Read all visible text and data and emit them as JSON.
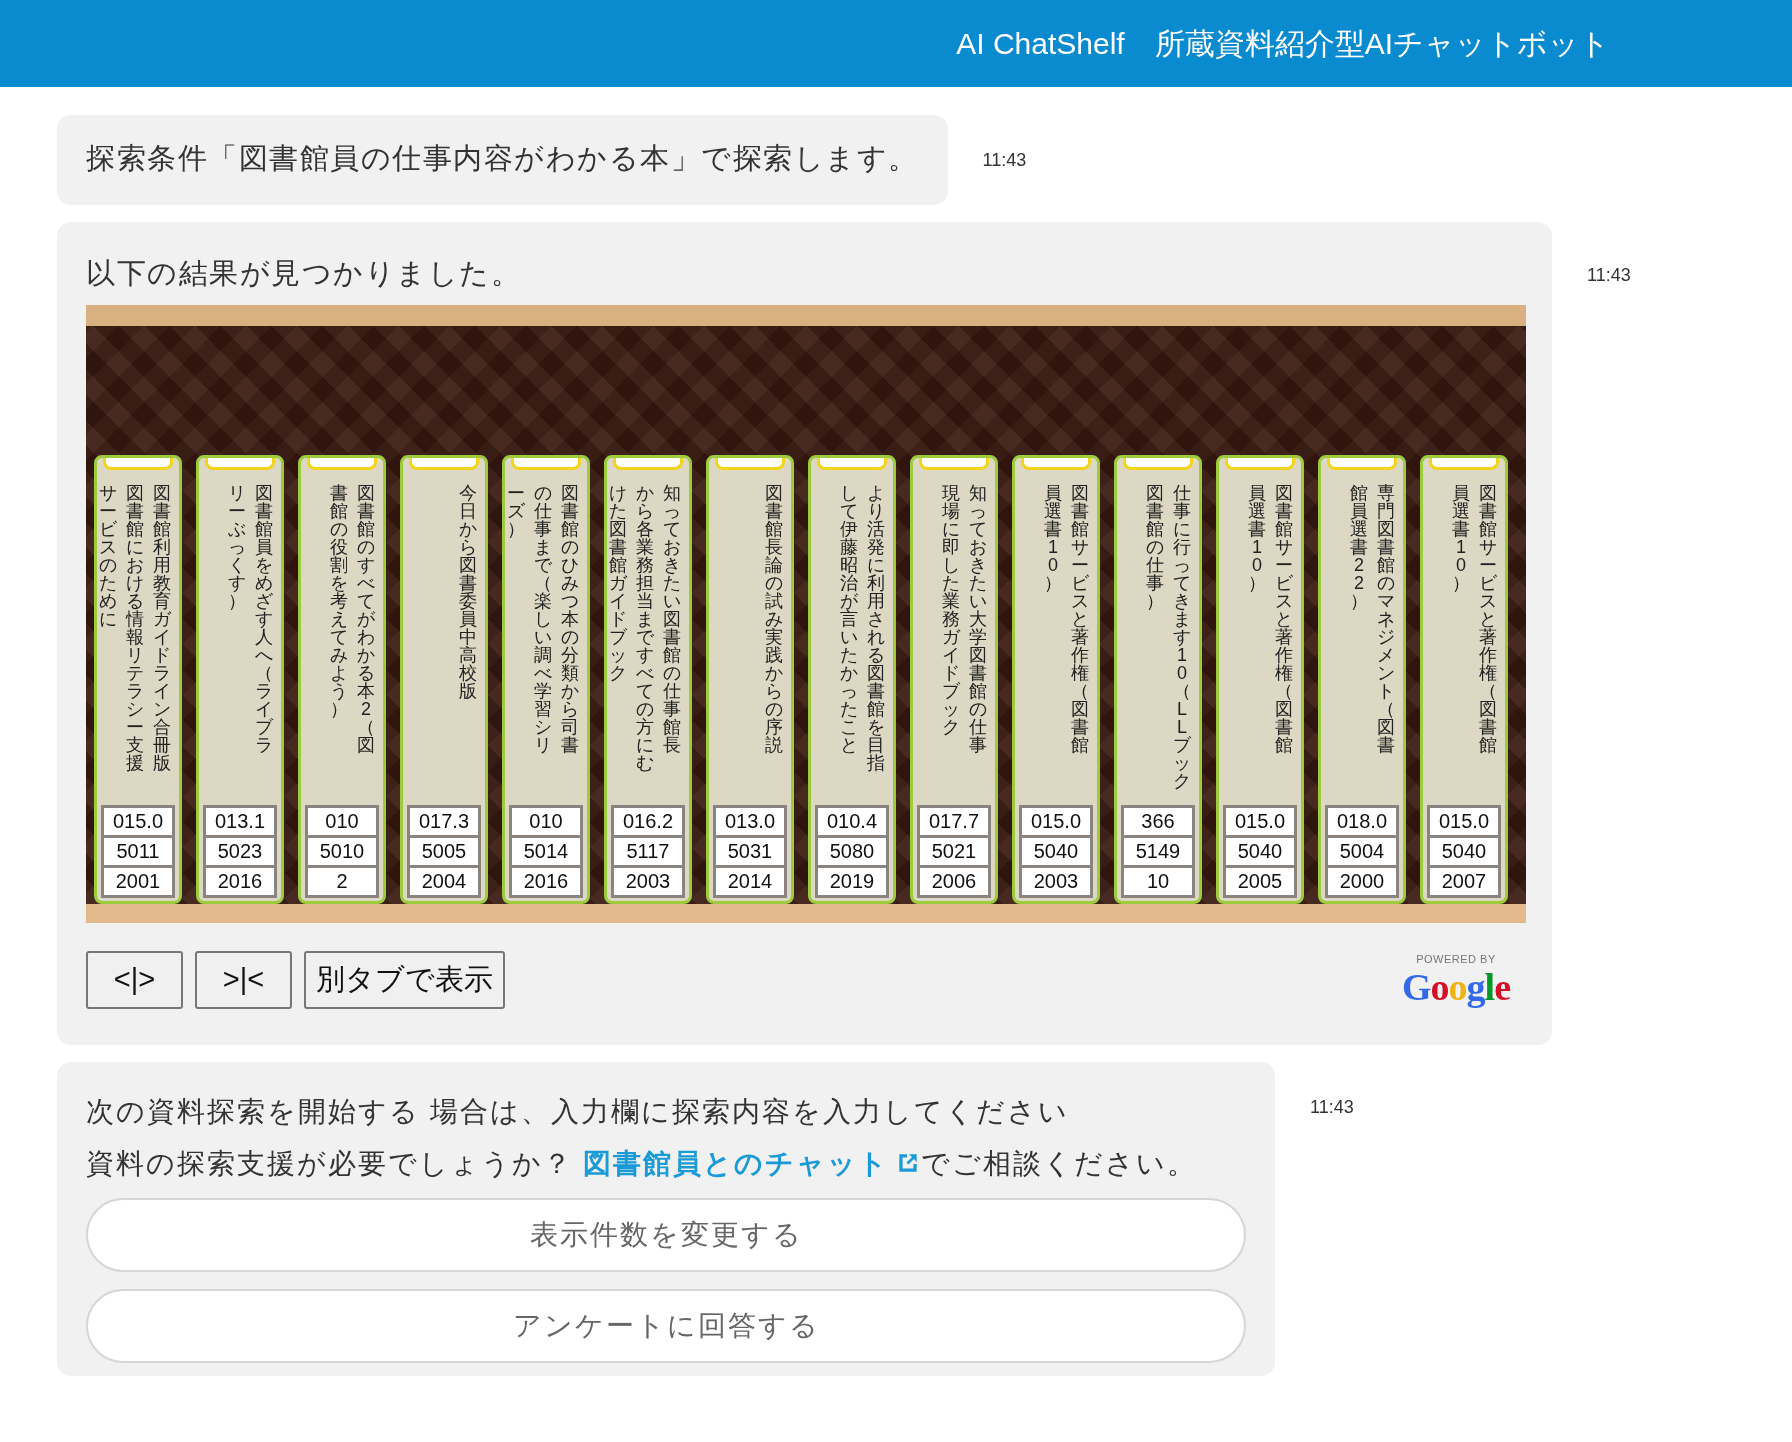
{
  "header": {
    "title": "AI ChatShelf　所蔵資料紹介型AIチャットボット"
  },
  "messages": [
    {
      "kind": "query",
      "text": "探索条件「図書館員の仕事内容がわかる本」で探索します。",
      "time": "11:43"
    },
    {
      "kind": "results",
      "text": "以下の結果が見つかりました。",
      "time": "11:43",
      "books": [
        {
          "spine_lines": [
            "サービスのために",
            "図書館における情報リテラシー支援",
            "図書館利用教育ガイドライン合冊版"
          ],
          "label_rows": [
            "015.0",
            "5011",
            "2001"
          ]
        },
        {
          "spine_lines": [
            "リーぶっくす）",
            "図書館員をめざす人へ（ライブラ"
          ],
          "label_rows": [
            "013.1",
            "5023",
            "2016"
          ]
        },
        {
          "spine_lines": [
            "書館の役割を考えてみよう）",
            "図書館のすべてがわかる本2（図"
          ],
          "label_rows": [
            "010",
            "5010",
            "2"
          ]
        },
        {
          "spine_lines": [
            "今日から図書委員中高校版"
          ],
          "label_rows": [
            "017.3",
            "5005",
            "2004"
          ]
        },
        {
          "spine_lines": [
            "ーズ）",
            "の仕事まで（楽しい調べ学習シリ",
            "図書館のひみつ本の分類から司書"
          ],
          "label_rows": [
            "010",
            "5014",
            "2016"
          ]
        },
        {
          "spine_lines": [
            "けた図書館ガイドブック",
            "から各業務担当まですべての方にむ",
            "知っておきたい図書館の仕事館長"
          ],
          "label_rows": [
            "016.2",
            "5117",
            "2003"
          ]
        },
        {
          "spine_lines": [
            "図書館長論の試み実践からの序説"
          ],
          "label_rows": [
            "013.0",
            "5031",
            "2014"
          ]
        },
        {
          "spine_lines": [
            "して伊藤昭治が言いたかったこと",
            "より活発に利用される図書館を目指"
          ],
          "label_rows": [
            "010.4",
            "5080",
            "2019"
          ]
        },
        {
          "spine_lines": [
            "現場に即した業務ガイドブック",
            "知っておきたい大学図書館の仕事"
          ],
          "label_rows": [
            "017.7",
            "5021",
            "2006"
          ]
        },
        {
          "spine_lines": [
            "員選書10）",
            "図書館サービスと著作権（図書館"
          ],
          "label_rows": [
            "015.0",
            "5040",
            "2003"
          ]
        },
        {
          "spine_lines": [
            "図書館の仕事）",
            "仕事に行ってきます10（LLブック"
          ],
          "label_rows": [
            "366",
            "5149",
            "10"
          ]
        },
        {
          "spine_lines": [
            "員選書10）",
            "図書館サービスと著作権（図書館"
          ],
          "label_rows": [
            "015.0",
            "5040",
            "2005"
          ]
        },
        {
          "spine_lines": [
            "館員選書22）",
            "専門図書館のマネジメント（図書"
          ],
          "label_rows": [
            "018.0",
            "5004",
            "2000"
          ]
        },
        {
          "spine_lines": [
            "員選書10）",
            "図書館サービスと著作権（図書館"
          ],
          "label_rows": [
            "015.0",
            "5040",
            "2007"
          ]
        }
      ],
      "shelf_buttons": [
        "<|>",
        ">|<",
        "別タブで表示"
      ],
      "powered_by": {
        "caption": "POWERED BY",
        "logo": "Google"
      }
    },
    {
      "kind": "prompt",
      "text": "次の資料探索を開始する 場合は、入力欄に探索内容を入力してください",
      "time": "11:43",
      "help": {
        "before": "資料の探索支援が必要でしょうか？ ",
        "link": "図書館員とのチャット",
        "after": "でご相談ください。"
      },
      "options": [
        "表示件数を変更する",
        "アンケートに回答する"
      ]
    }
  ]
}
